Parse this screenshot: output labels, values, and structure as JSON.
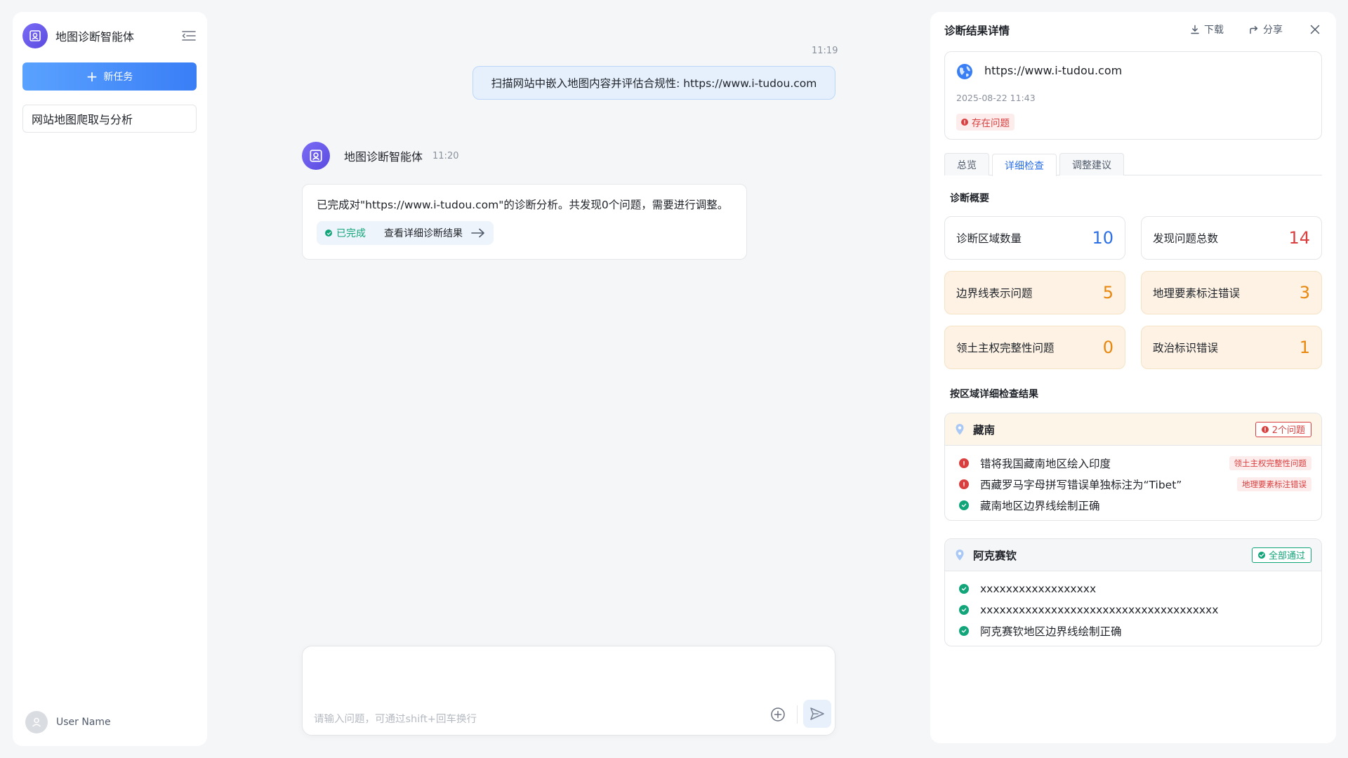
{
  "sidebar": {
    "app_name": "地图诊断智能体",
    "new_task_label": "新任务",
    "tasks": [
      {
        "label": "网站地图爬取与分析"
      }
    ],
    "user_name": "User Name"
  },
  "chat": {
    "user_time": "11:19",
    "user_message": "扫描网站中嵌入地图内容并评估合规性: https://www.i-tudou.com",
    "bot_name": "地图诊断智能体",
    "bot_time": "11:20",
    "bot_message": "已完成对\"https://www.i-tudou.com\"的诊断分析。共发现0个问题，需要进行调整。",
    "status_label": "已完成",
    "detail_link_label": "查看详细诊断结果",
    "input_placeholder": "请输入问题，可通过shift+回车换行"
  },
  "panel": {
    "title": "诊断结果详情",
    "download_label": "下载",
    "share_label": "分享",
    "url": "https://www.i-tudou.com",
    "date": "2025-08-22 11:43",
    "issue_badge": "存在问题",
    "tabs": [
      {
        "label": "总览"
      },
      {
        "label": "详细检查"
      },
      {
        "label": "调整建议"
      }
    ],
    "active_tab": 1,
    "summary_title": "诊断概要",
    "stats": [
      {
        "label": "诊断区域数量",
        "value": "10",
        "color": "#2b6fe6",
        "style": "plain"
      },
      {
        "label": "发现问题总数",
        "value": "14",
        "color": "#d93f3f",
        "style": "plain"
      },
      {
        "label": "边界线表示问题",
        "value": "5",
        "color": "#e8870e",
        "style": "warn"
      },
      {
        "label": "地理要素标注错误",
        "value": "3",
        "color": "#e8870e",
        "style": "warn"
      },
      {
        "label": "领土主权完整性问题",
        "value": "0",
        "color": "#e8870e",
        "style": "warn"
      },
      {
        "label": "政治标识错误",
        "value": "1",
        "color": "#e8870e",
        "style": "warn"
      }
    ],
    "regions_title": "按区域详细检查结果",
    "regions": [
      {
        "name": "藏南",
        "tag": "2个问题",
        "status": "bad",
        "checks": [
          {
            "text": "错将我国藏南地区绘入印度",
            "status": "bad",
            "tag": "领土主权完整性问题"
          },
          {
            "text": "西藏罗马字母拼写错误单独标注为“Tibet”",
            "status": "bad",
            "tag": "地理要素标注错误"
          },
          {
            "text": "藏南地区边界线绘制正确",
            "status": "good",
            "tag": ""
          }
        ]
      },
      {
        "name": "阿克赛钦",
        "tag": "全部通过",
        "status": "good",
        "checks": [
          {
            "text": "xxxxxxxxxxxxxxxxxx",
            "status": "good",
            "tag": ""
          },
          {
            "text": "xxxxxxxxxxxxxxxxxxxxxxxxxxxxxxxxxxxxx",
            "status": "good",
            "tag": ""
          },
          {
            "text": "阿克赛钦地区边界线绘制正确",
            "status": "good",
            "tag": ""
          }
        ]
      }
    ]
  }
}
